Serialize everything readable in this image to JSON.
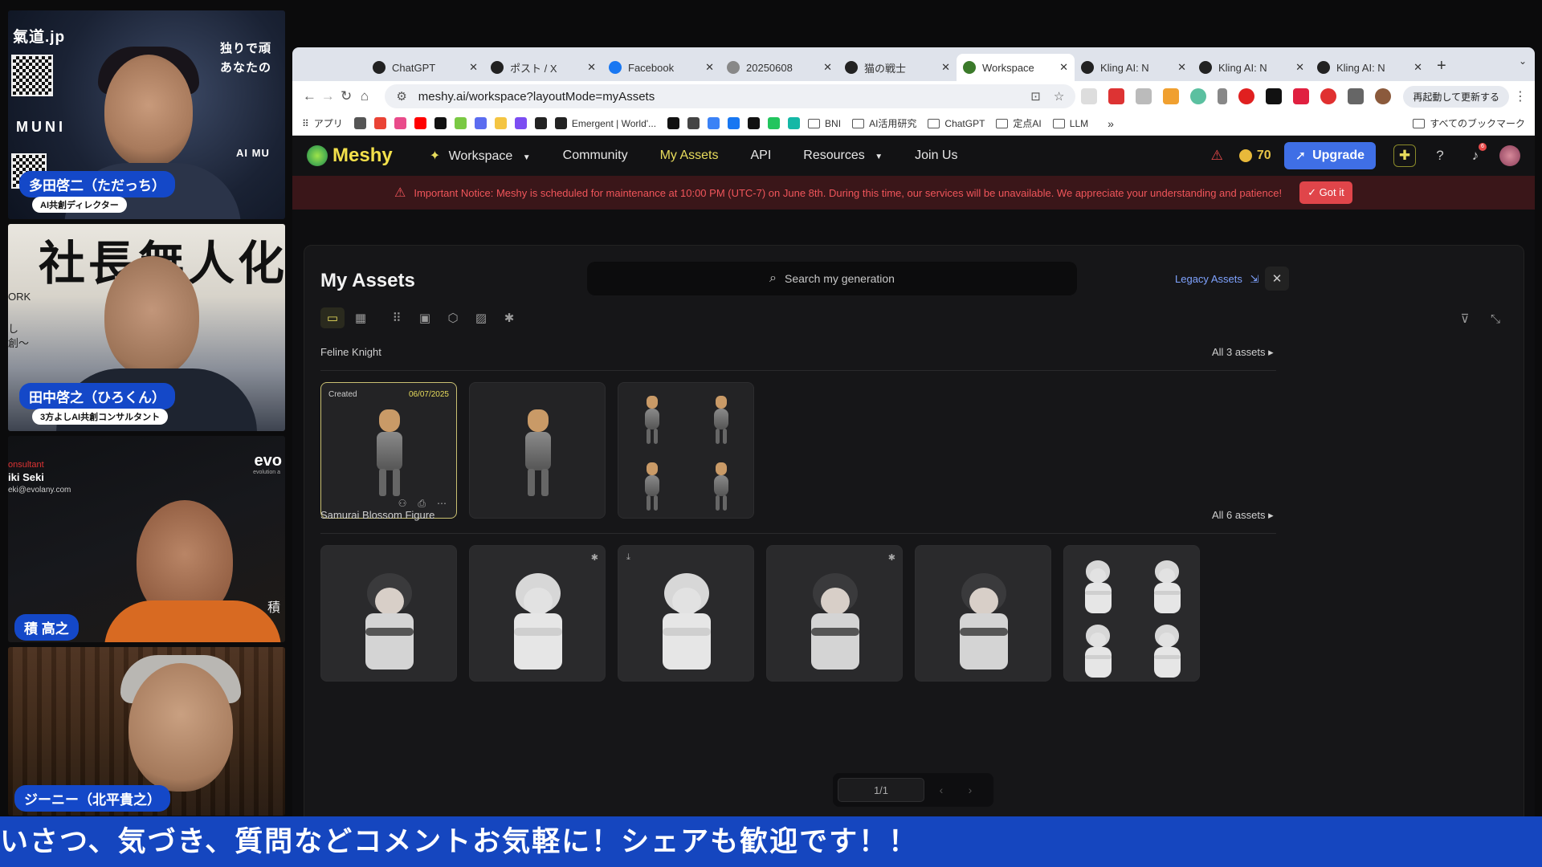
{
  "stream": {
    "videos": [
      {
        "top_text": "氣道.jp",
        "right_text_1": "独りで頑",
        "right_text_2": "あなたの",
        "mid_text": "MUNI",
        "mid_text_2": "AI MU",
        "name": "多田啓二（ただっち）",
        "role": "AI共創ディレクター"
      },
      {
        "kanji": "社長無人化",
        "side_text": "ORK",
        "side_text_2": "し",
        "side_text_3": "創〜",
        "name": "田中啓之（ひろくん）",
        "role": "3方よしAI共創コンサルタント"
      },
      {
        "consultant": "onsultant",
        "person": "iki Seki",
        "email": "eki@evolany.com",
        "brand": "evo",
        "brand_sub": "evolution a",
        "kanji": "積",
        "name": "積 高之"
      },
      {
        "name": "ジーニー（北平貴之）"
      }
    ],
    "banner": "いさつ、気づき、質問などコメントお気軽に！シェアも歓迎です！！"
  },
  "browser": {
    "tabs": [
      {
        "label": "ChatGPT",
        "icon": "openai-icon"
      },
      {
        "label": "ポスト / X",
        "icon": "x-icon"
      },
      {
        "label": "Facebook",
        "icon": "facebook-icon"
      },
      {
        "label": "20250608",
        "icon": "apple-icon"
      },
      {
        "label": "猫の戦士",
        "icon": "openai-icon"
      },
      {
        "label": "Workspace",
        "icon": "meshy-icon",
        "active": true
      },
      {
        "label": "Kling AI: N",
        "icon": "kling-icon"
      },
      {
        "label": "Kling AI: N",
        "icon": "kling-icon"
      },
      {
        "label": "Kling AI: N",
        "icon": "kling-icon"
      }
    ],
    "url": "meshy.ai/workspace?layoutMode=myAssets",
    "update_button": "再起動して更新する",
    "bookmarks": [
      {
        "label": "アプリ",
        "type": "apps"
      },
      {
        "label": "",
        "type": "icon",
        "color": "#555"
      },
      {
        "label": "",
        "type": "icon",
        "color": "#ea4335"
      },
      {
        "label": "",
        "type": "icon",
        "color": "#e94b8a"
      },
      {
        "label": "",
        "type": "icon",
        "color": "#ff0000"
      },
      {
        "label": "",
        "type": "icon",
        "color": "#111111"
      },
      {
        "label": "",
        "type": "icon",
        "color": "#7ac943"
      },
      {
        "label": "",
        "type": "icon",
        "color": "#5b6cf0"
      },
      {
        "label": "",
        "type": "icon",
        "color": "#f4c542"
      },
      {
        "label": "",
        "type": "icon",
        "color": "#7b4df2"
      },
      {
        "label": "",
        "type": "icon",
        "color": "#222"
      },
      {
        "label": "Emergent | World'...",
        "type": "site",
        "color": "#222"
      },
      {
        "label": "",
        "type": "icon",
        "color": "#111"
      },
      {
        "label": "",
        "type": "icon",
        "color": "#444"
      },
      {
        "label": "",
        "type": "icon",
        "color": "#3b82f6"
      },
      {
        "label": "",
        "type": "icon",
        "color": "#1877f2"
      },
      {
        "label": "",
        "type": "icon",
        "color": "#111"
      },
      {
        "label": "",
        "type": "icon",
        "color": "#22c55e"
      },
      {
        "label": "",
        "type": "icon",
        "color": "#14b8a6"
      },
      {
        "label": "BNI",
        "type": "folder"
      },
      {
        "label": "AI活用研究",
        "type": "folder"
      },
      {
        "label": "ChatGPT",
        "type": "folder"
      },
      {
        "label": "定点AI",
        "type": "folder"
      },
      {
        "label": "LLM",
        "type": "folder"
      }
    ],
    "bookmarks_more": "»",
    "all_bookmarks": "すべてのブックマーク"
  },
  "app": {
    "brand": "Meshy",
    "nav": [
      {
        "label": "Workspace",
        "dropdown": true,
        "icon": "sparkle-icon"
      },
      {
        "label": "Community"
      },
      {
        "label": "My Assets",
        "active": true
      },
      {
        "label": "API"
      },
      {
        "label": "Resources",
        "dropdown": true
      },
      {
        "label": "Join Us"
      }
    ],
    "credits": "70",
    "upgrade_label": "Upgrade",
    "notification_count": "6",
    "notice": "Important Notice: Meshy is scheduled for maintenance at 10:00 PM (UTC-7) on June 8th. During this time, our services will be unavailable. We appreciate your understanding and patience!",
    "notice_button": "Got it",
    "colors": {
      "accent": "#e8dc5c",
      "upgrade": "#3f6fe6",
      "notice": "#f0555a"
    }
  },
  "assets": {
    "title": "My Assets",
    "search_placeholder": "Search my generation",
    "legacy_label": "Legacy Assets",
    "groups": [
      {
        "title": "Feline Knight",
        "all_label": "All 3 assets",
        "cards": [
          {
            "kind": "knight",
            "created_label": "Created",
            "date": "06/07/2025",
            "selected": true
          },
          {
            "kind": "knight"
          },
          {
            "kind": "knight-quad"
          }
        ]
      },
      {
        "title": "Samurai Blossom Figure",
        "all_label": "All 6 assets",
        "cards": [
          {
            "kind": "samurai-dark"
          },
          {
            "kind": "samurai-white",
            "corner_icon": "rig-icon"
          },
          {
            "kind": "samurai-white",
            "corner_icon_left": "download-icon"
          },
          {
            "kind": "samurai-dark",
            "corner_icon": "rig-icon"
          },
          {
            "kind": "samurai-dark"
          },
          {
            "kind": "samurai-quad"
          }
        ]
      }
    ],
    "pagination": "1/1"
  }
}
